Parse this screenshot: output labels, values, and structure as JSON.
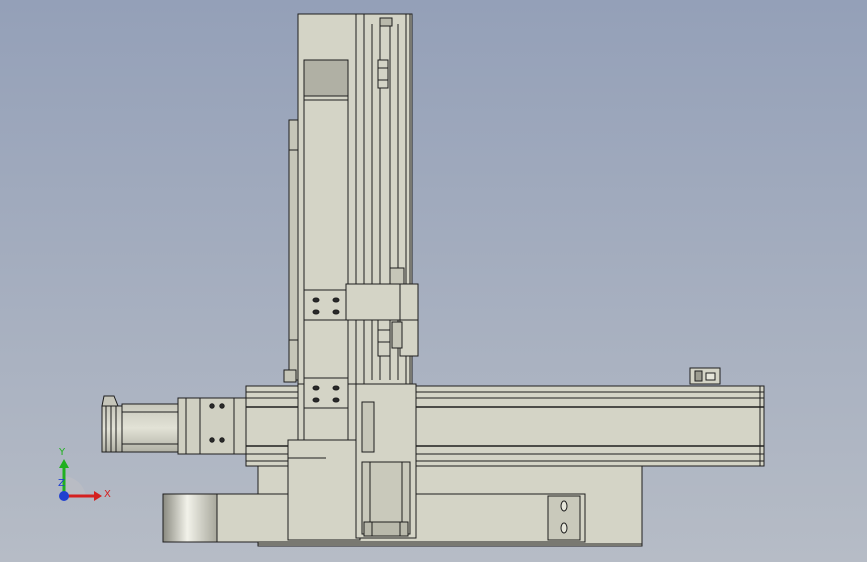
{
  "viewport": {
    "background_top": "#94a0b8",
    "background_bottom": "#b6bcc6"
  },
  "part_colors": {
    "body": "#d4d4c6",
    "shade": "#b9b9ab",
    "dark": "#9c9c90",
    "outline": "#1e1e1e"
  },
  "triad": {
    "x_label": "X",
    "y_label": "Y",
    "z_label": "Z",
    "x_color": "#d42020",
    "y_color": "#20b020",
    "z_color": "#2040d0"
  }
}
